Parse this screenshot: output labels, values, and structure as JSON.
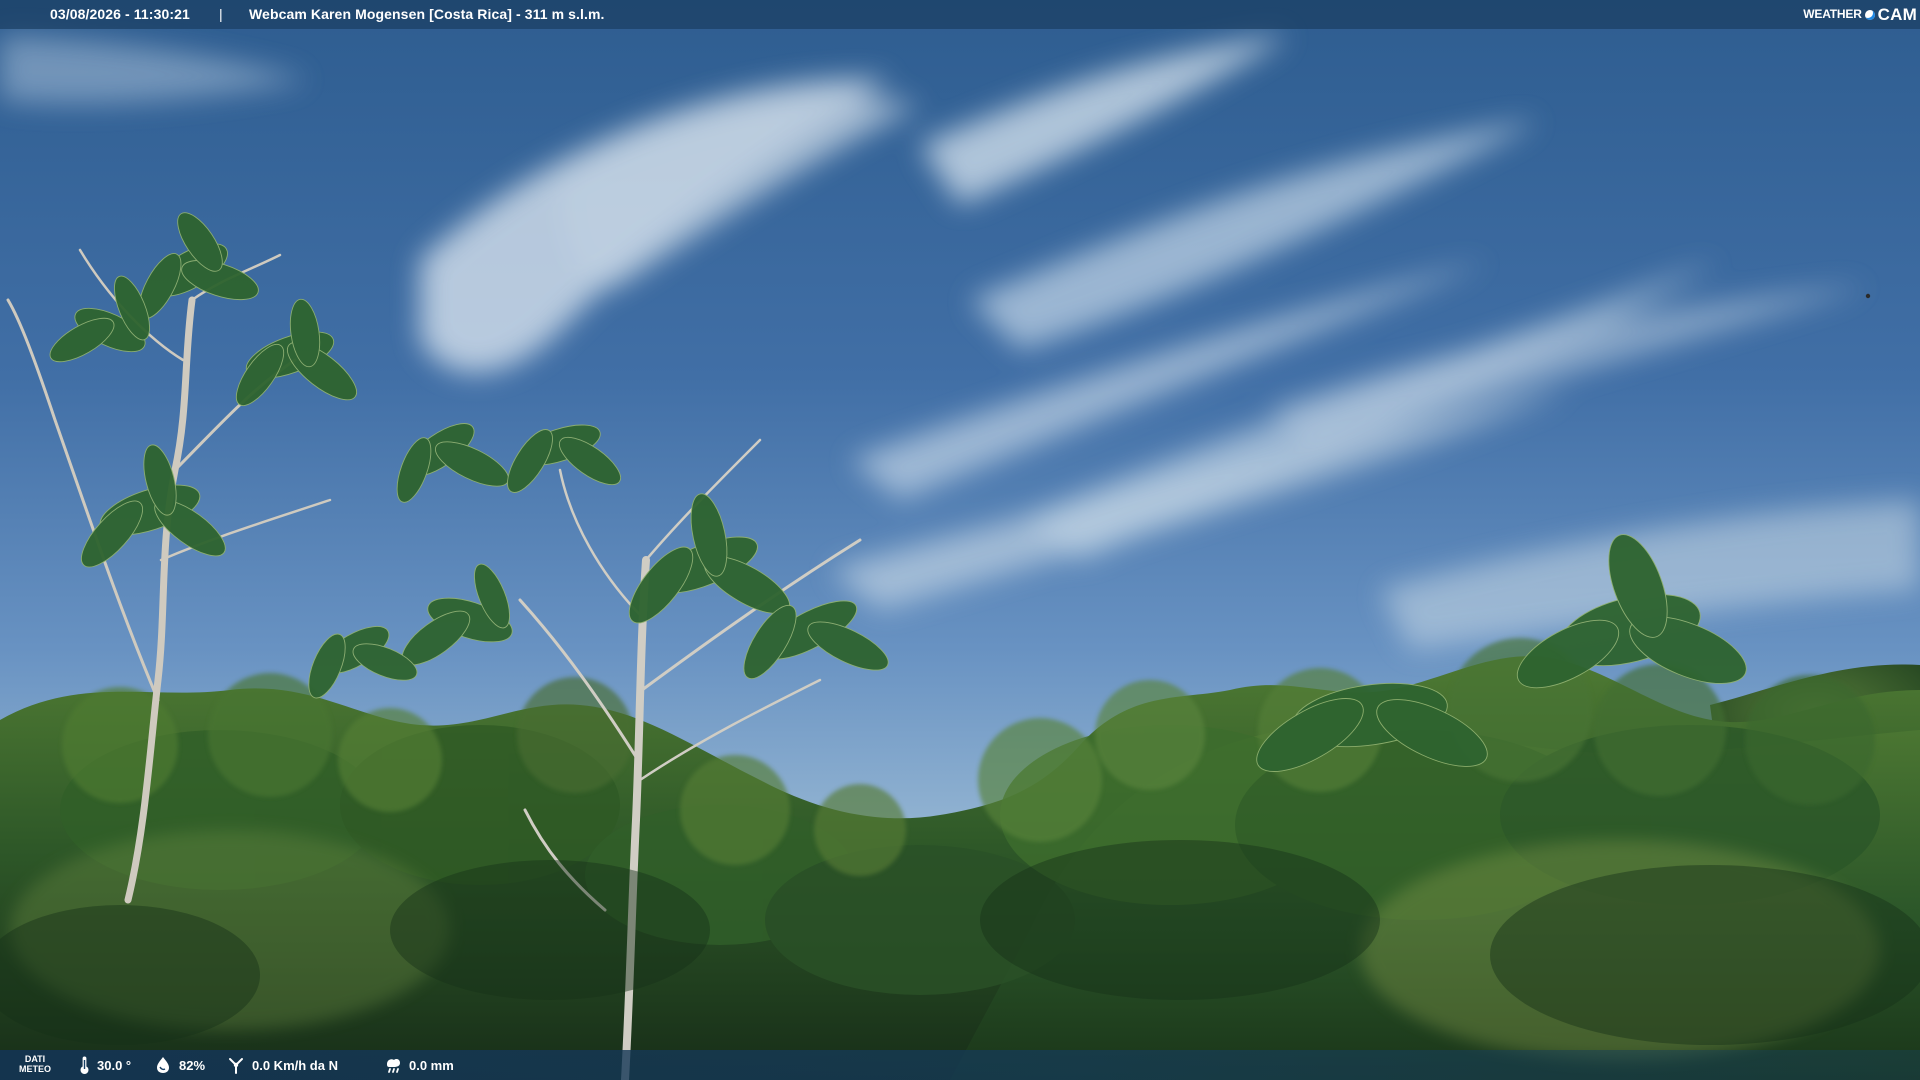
{
  "overlay": {
    "datetime": "03/08/2026 - 11:30:21",
    "separator": "|",
    "camera_title": "Webcam Karen Mogensen [Costa Rica] - 311 m s.l.m.",
    "brand_left": "WEATHER",
    "brand_right": "CAM"
  },
  "meteo": {
    "label_line1": "DATI",
    "label_line2": "METEO",
    "temperature": "30.0 °",
    "humidity": "82%",
    "wind": "0.0 Km/h da N",
    "rain": "0.0 mm"
  },
  "colors": {
    "sky_top": "#2f5f93",
    "sky_mid": "#5d8fbe",
    "sky_low": "#d8e3e6",
    "cloud": "#dce8ef",
    "forest_dark": "#1b3519",
    "forest_mid": "#2d5b26",
    "forest_light": "#5a7f34",
    "trunk": "#c5c2b8"
  },
  "icons": {
    "temperature": "thermometer-icon",
    "humidity": "humidity-icon",
    "wind": "wind-icon",
    "rain": "rain-icon",
    "brand": "weathercam-logo-icon"
  }
}
